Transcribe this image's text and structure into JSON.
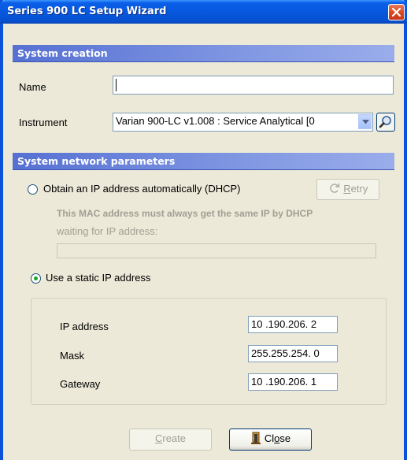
{
  "window": {
    "title": "Series 900 LC Setup Wizard"
  },
  "system_creation": {
    "header": "System creation",
    "name_label": "Name",
    "name_value": "",
    "instrument_label": "Instrument",
    "instrument_value": "Varian 900-LC v1.008 : Service Analytical [0"
  },
  "network": {
    "header": "System network parameters",
    "dhcp_option_label": "Obtain an IP address automatically (DHCP)",
    "dhcp_selected": false,
    "retry_prefix": "",
    "retry_mnemonic": "R",
    "retry_suffix": "etry",
    "mac_note": "This MAC address must always get the same IP by DHCP",
    "waiting_text": "waiting for IP address:",
    "static_option_label": "Use a static IP address",
    "static_selected": true,
    "ip_label": "IP address",
    "ip_value": "10 .190.206.  2",
    "mask_label": "Mask",
    "mask_value": "255.255.254.  0",
    "gateway_label": "Gateway",
    "gateway_value": "10 .190.206.  1"
  },
  "buttons": {
    "create_mnemonic": "C",
    "create_suffix": "reate",
    "close_prefix": "Cl",
    "close_mnemonic": "o",
    "close_suffix": "se"
  },
  "colors": {
    "accent": "#0b52d9",
    "section_header": "#7087dc",
    "dialog_bg": "#ece9d8",
    "radio_dot": "#21a121",
    "close_button": "#d8461f"
  },
  "icons": {
    "close": "close-x-icon",
    "search": "magnifier-icon",
    "dropdown": "chevron-down-icon",
    "retry": "refresh-icon",
    "close_door": "door-icon"
  }
}
